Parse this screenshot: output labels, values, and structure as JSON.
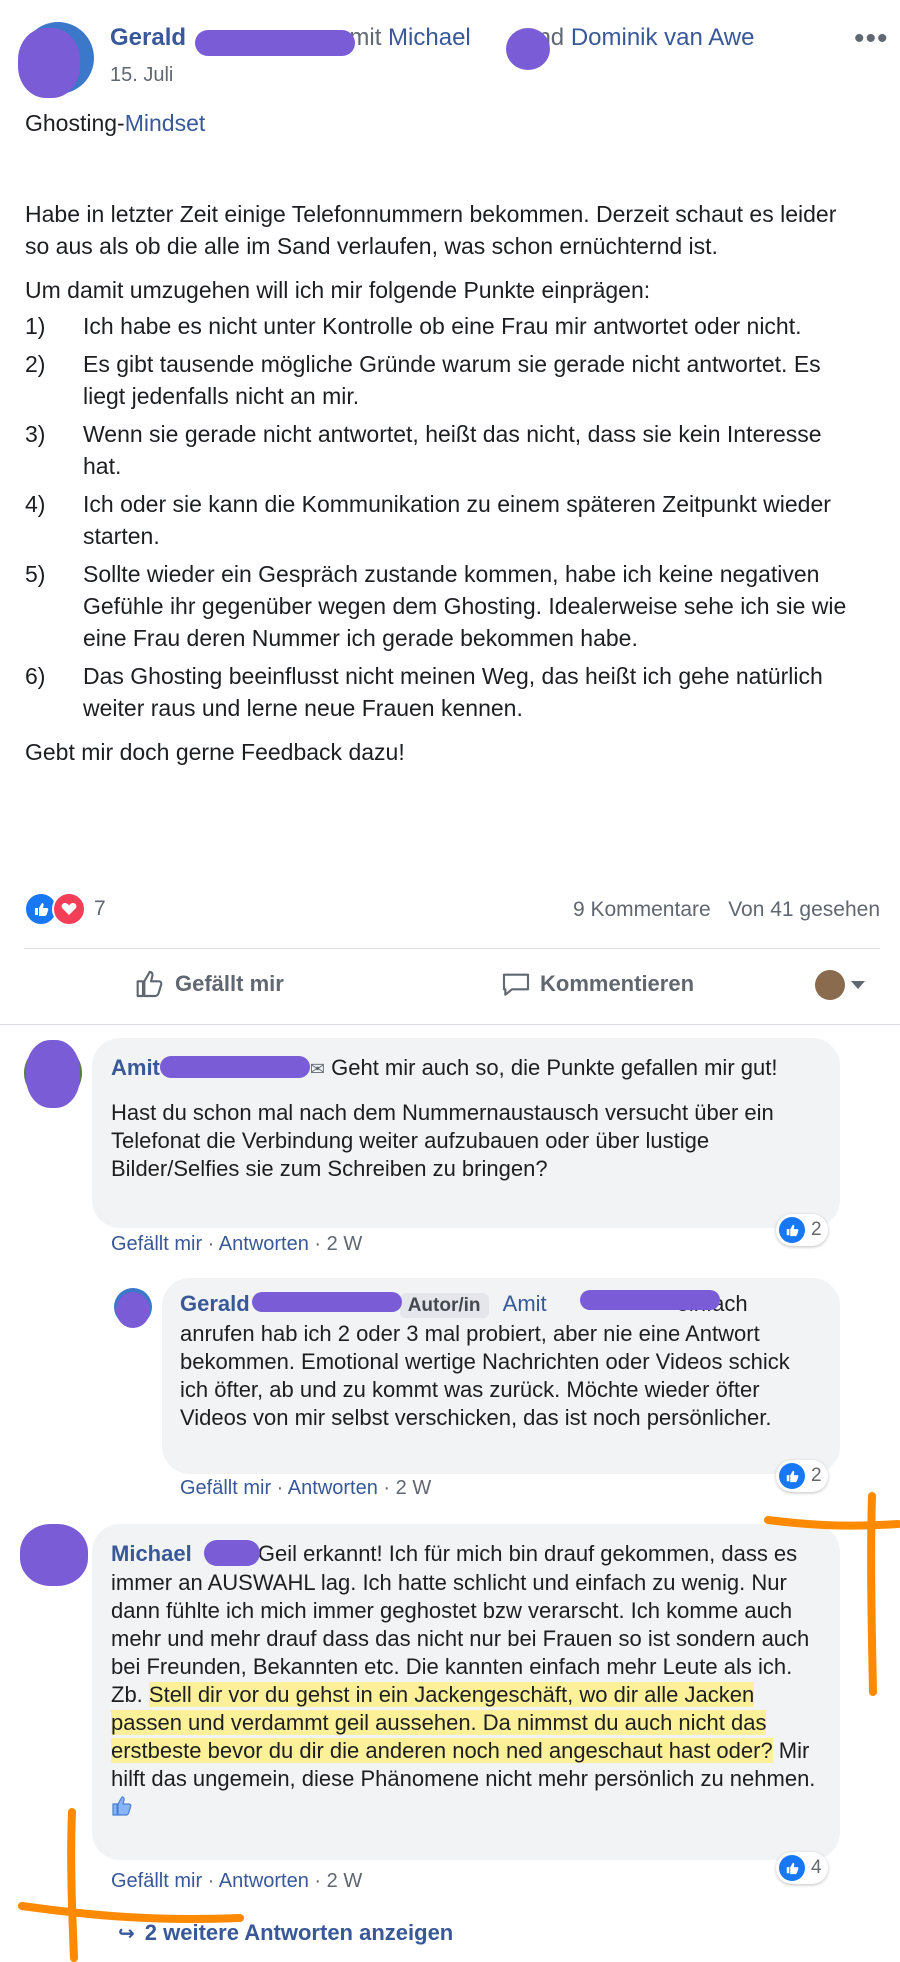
{
  "post": {
    "author": "Gerald",
    "with_text": "mit",
    "tag1": "Michael",
    "and_text": "und",
    "tag2": "Dominik van Awe",
    "date": "15. Juli",
    "title_plain": "Ghosting-",
    "title_link": "Mindset",
    "para1": "Habe in letzter Zeit einige Telefonnummern bekommen. Derzeit schaut es leider so aus als ob die alle im Sand verlaufen, was schon ernüchternd ist.",
    "para2": "Um damit umzugehen will ich mir folgende Punkte einprägen:",
    "points": [
      {
        "num": "1)",
        "text": "Ich habe es nicht unter Kontrolle ob eine Frau mir antwortet oder nicht."
      },
      {
        "num": "2)",
        "text": "Es gibt tausende mögliche Gründe warum sie gerade nicht antwortet. Es liegt jedenfalls nicht an mir."
      },
      {
        "num": "3)",
        "text": "Wenn sie gerade nicht antwortet, heißt das nicht, dass sie kein Interesse hat."
      },
      {
        "num": "4)",
        "text": "Ich oder sie kann die Kommunikation zu einem späteren Zeitpunkt wieder starten."
      },
      {
        "num": "5)",
        "text": "Sollte wieder ein Gespräch zustande kommen, habe ich keine negativen Gefühle ihr gegenüber wegen dem Ghosting. Idealerweise sehe ich sie wie eine Frau deren Nummer ich gerade bekommen habe."
      },
      {
        "num": "6)",
        "text": "Das Ghosting beeinflusst nicht meinen Weg, das heißt ich gehe natürlich weiter raus und lerne neue Frauen kennen."
      }
    ],
    "closing": "Gebt mir doch gerne Feedback dazu!",
    "reaction_count": "7",
    "comments_count": "9 Kommentare",
    "seen_by": "Von 41 gesehen"
  },
  "actions": {
    "like": "Gefällt mir",
    "comment": "Kommentieren"
  },
  "comments": [
    {
      "author": "Amit",
      "text1": "Geht mir auch so, die Punkte gefallen mir gut!",
      "text2": "Hast du schon mal nach dem Nummernaustausch versucht über ein Telefonat die Verbindung weiter aufzubauen oder über lustige Bilder/Selfies sie zum Schreiben zu bringen?",
      "like": "Gefällt mir",
      "reply": "Antworten",
      "time": "2 W",
      "likes": "2"
    },
    {
      "author": "Gerald",
      "badge": "Autor/in",
      "mention": "Amit",
      "text_first": "einfach",
      "text_rest": "anrufen hab ich 2 oder 3 mal probiert, aber nie eine Antwort bekommen. Emotional wertige Nachrichten oder Videos schick ich öfter, ab und zu kommt was zurück. Möchte wieder öfter Videos von mir selbst verschicken, das ist noch persönlicher.",
      "like": "Gefällt mir",
      "reply": "Antworten",
      "time": "2 W",
      "likes": "2"
    },
    {
      "author": "Michael",
      "text_a": "Geil erkannt! Ich für mich bin drauf gekommen, dass es immer an AUSWAHL lag. Ich hatte schlicht und einfach zu wenig. Nur dann fühlte ich mich immer geghostet bzw verarscht. Ich komme auch mehr und mehr drauf dass das nicht nur bei Frauen so ist sondern auch bei Freunden, Bekannten etc. Die kannten einfach mehr Leute als ich. Zb. ",
      "text_hl": "Stell dir vor du gehst in ein Jackengeschäft, wo dir alle Jacken passen und verdammt geil aussehen. Da nimmst du auch nicht das erstbeste bevor du dir die anderen noch ned angeschaut hast oder?",
      "text_b": " Mir hilft das ungemein, diese Phänomene nicht mehr persönlich zu nehmen.",
      "like": "Gefällt mir",
      "reply": "Antworten",
      "time": "2 W",
      "likes": "4"
    }
  ],
  "more_replies": "2 weitere Antworten anzeigen",
  "colors": {
    "link": "#385898",
    "redaction": "#7a5cd6",
    "annotation": "#ff8a00",
    "highlight": "#fff27a"
  }
}
